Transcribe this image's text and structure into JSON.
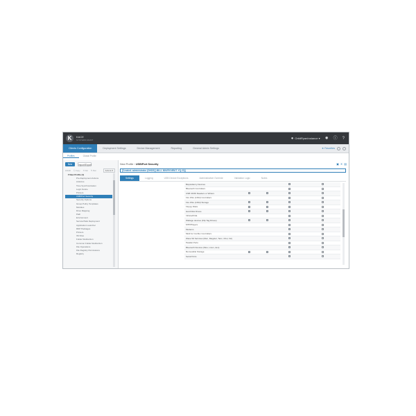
{
  "app": {
    "logo_letter": "K",
    "brand_name": "KACE",
    "brand_sub": "SYSTEMS MGMT",
    "user": "OrbitRyanInstance ▾"
  },
  "nav": {
    "tabs": [
      "Clients Configuration",
      "Deployment Settings",
      "Device Management",
      "Reporting",
      "General Admin Settings"
    ],
    "favorites_label": "★ Favorites"
  },
  "subnav": [
    "Profiles",
    "Global Profile"
  ],
  "sidebar": {
    "new_label": "New",
    "import_label": "Import/Export",
    "tools": [
      "⊞ Edit",
      "⎘ Copy",
      "✕ Del",
      "✎ Ren"
    ],
    "filter_label": "Actions ▾",
    "root_item": "▾ New Profile (1)",
    "items": [
      "Pre-Deployment Actions",
      "Antivirus",
      "Time Synchronization",
      "Login Notice",
      "Printers",
      "USB/Port Security",
      "Security Options",
      "Group Policy Templates",
      "Modules",
      "Drive Mapping",
      "Path",
      "Environment",
      "Service/Task Deployment",
      "Application Launcher",
      "RDP Packages",
      "Printers",
      "INI Files",
      "Folder Redirection",
      "Common Folder Redirection",
      "File Operations",
      "File Registry Permissions",
      "Registry"
    ],
    "selected_index": 5
  },
  "main": {
    "crumb_parent": "New Profile",
    "crumb_sep": "›",
    "crumb_current": "USB/Port Security",
    "created": "[Created: administrator (DHOSQ.IM.LI. NNVRY.NRUT. YQ.23)]",
    "tabs": [
      "Settings",
      "Logging",
      "USB Device Exceptions",
      "Administrative Override",
      "Validation Logic",
      "Notes"
    ],
    "active_tab": 0,
    "rows": [
      {
        "name": "Biopsidterny Devices",
        "c1": false,
        "c2": false,
        "c3": true,
        "c4": false
      },
      {
        "name": "Bluetooth Controllers",
        "c1": false,
        "c2": false,
        "c3": true,
        "c4": false
      },
      {
        "name": "USB CD/Dl Readers or Writers",
        "c1": true,
        "c2": true,
        "c3": true,
        "c4": false
      },
      {
        "name": "Fire Wire (1394) Controllers",
        "c1": false,
        "c2": false,
        "c3": true,
        "c4": false
      },
      {
        "name": "Fire Wire (1394) Storage",
        "c1": true,
        "c2": true,
        "c3": true,
        "c4": false
      },
      {
        "name": "Floppy Disks",
        "c1": true,
        "c2": true,
        "c3": true,
        "c4": false
      },
      {
        "name": "Hard Disk Drives",
        "c1": true,
        "c2": true,
        "c3": true,
        "c4": false
      },
      {
        "name": "Infrared/Irda",
        "c1": false,
        "c2": false,
        "c3": true,
        "c4": false
      },
      {
        "name": "Wattage devices (Flip Tag Drives)",
        "c1": true,
        "c2": true,
        "c3": true,
        "c4": false
      },
      {
        "name": "MTP/Players",
        "c1": false,
        "c2": false,
        "c3": true,
        "c4": false
      },
      {
        "name": "Modems",
        "c1": false,
        "c2": false,
        "c3": true,
        "c4": false
      },
      {
        "name": "Multi for Conflux Controllers",
        "c1": false,
        "c2": false,
        "c3": true,
        "c4": false
      },
      {
        "name": "Wave Wt Services (Disc, Reigster, Tenc, Choi, Iric)",
        "c1": false,
        "c2": false,
        "c3": true,
        "c4": false
      },
      {
        "name": "Parallel Ports",
        "c1": false,
        "c2": false,
        "c3": true,
        "c4": false
      },
      {
        "name": "Bluetooth Devices (Mou, Licen, den)",
        "c1": false,
        "c2": false,
        "c3": true,
        "c4": false
      },
      {
        "name": "Removable Storage",
        "c1": true,
        "c2": true,
        "c3": true,
        "c4": false
      },
      {
        "name": "Serial Ports",
        "c1": false,
        "c2": false,
        "c3": true,
        "c4": false
      }
    ]
  }
}
